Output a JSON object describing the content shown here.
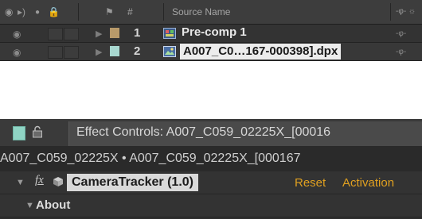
{
  "timeline": {
    "header": {
      "source_name_label": "Source Name",
      "number_label": "#"
    },
    "layers": [
      {
        "number": "1",
        "name": "Pre-comp 1",
        "label_color": "#b89a6a",
        "icon": "composition-icon"
      },
      {
        "number": "2",
        "name": "A007_C0…167-000398].dpx",
        "label_color": "#a8d8d0",
        "icon": "footage-icon"
      }
    ]
  },
  "effect_controls": {
    "title": "Effect Controls: A007_C059_02225X_[00016",
    "breadcrumb": "A007_C059_02225X • A007_C059_02225X_[000167",
    "effect": {
      "name": "CameraTracker (1.0)",
      "reset_label": "Reset",
      "activation_label": "Activation"
    },
    "about_label": "About"
  },
  "colors": {
    "panel_bg": "#2d2d2d",
    "accent_link": "#e0a020",
    "selection_bg": "#ececec"
  }
}
